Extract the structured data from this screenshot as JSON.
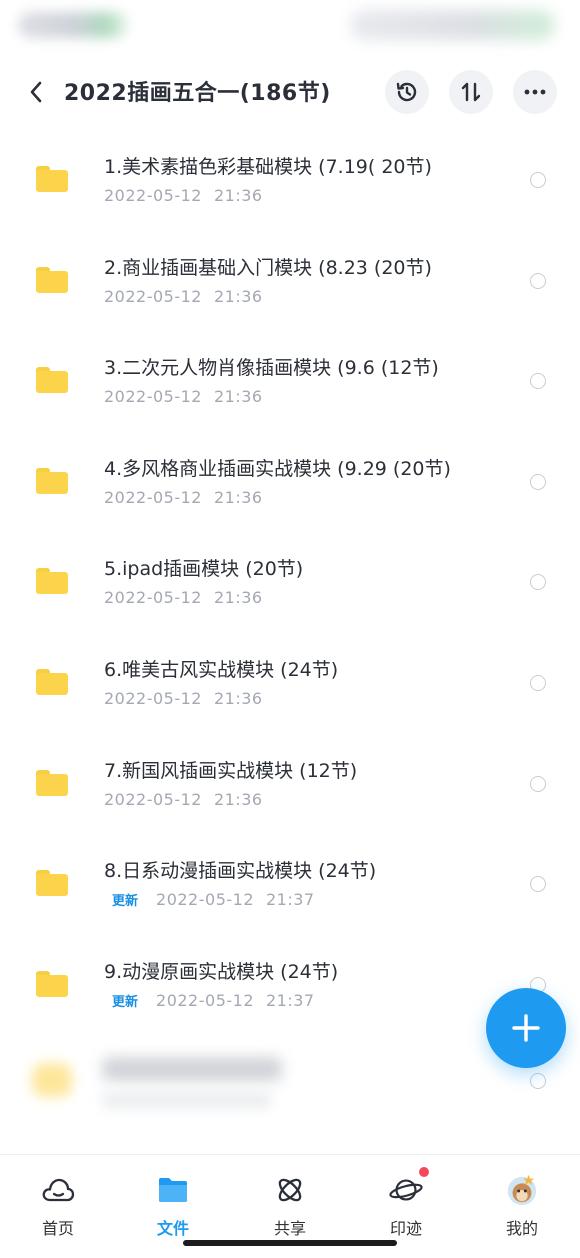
{
  "header": {
    "title": "2022插画五合一(186节)",
    "icons": [
      "back-chevron",
      "history-clock",
      "sort-arrows",
      "more-dots"
    ]
  },
  "files": [
    {
      "name": "1.美术素描色彩基础模块 (7.19( 20节)",
      "date": "2022-05-12",
      "time": "21:36",
      "badge": ""
    },
    {
      "name": "2.商业插画基础入门模块 (8.23 (20节)",
      "date": "2022-05-12",
      "time": "21:36",
      "badge": ""
    },
    {
      "name": "3.二次元人物肖像插画模块 (9.6 (12节)",
      "date": "2022-05-12",
      "time": "21:36",
      "badge": ""
    },
    {
      "name": "4.多风格商业插画实战模块 (9.29 (20节)",
      "date": "2022-05-12",
      "time": "21:36",
      "badge": ""
    },
    {
      "name": "5.ipad插画模块 (20节)",
      "date": "2022-05-12",
      "time": "21:36",
      "badge": ""
    },
    {
      "name": "6.唯美古风实战模块 (24节)",
      "date": "2022-05-12",
      "time": "21:36",
      "badge": ""
    },
    {
      "name": "7.新国风插画实战模块 (12节)",
      "date": "2022-05-12",
      "time": "21:36",
      "badge": ""
    },
    {
      "name": "8.日系动漫插画实战模块 (24节)",
      "date": "2022-05-12",
      "time": "21:37",
      "badge": "更新"
    },
    {
      "name": "9.动漫原画实战模块 (24节)",
      "date": "2022-05-12",
      "time": "21:37",
      "badge": "更新"
    }
  ],
  "tabbar": [
    {
      "label": "首页",
      "icon": "cloud-home-icon",
      "active": false
    },
    {
      "label": "文件",
      "icon": "folder-icon",
      "active": true
    },
    {
      "label": "共享",
      "icon": "atom-share-icon",
      "active": false
    },
    {
      "label": "印迹",
      "icon": "planet-icon",
      "active": false
    },
    {
      "label": "我的",
      "icon": "avatar",
      "active": false
    }
  ],
  "colors": {
    "accent": "#1e9bf0",
    "folder": "#fbd44b",
    "meta_text": "#a3a8b3",
    "notification_dot": "#f2485e"
  }
}
